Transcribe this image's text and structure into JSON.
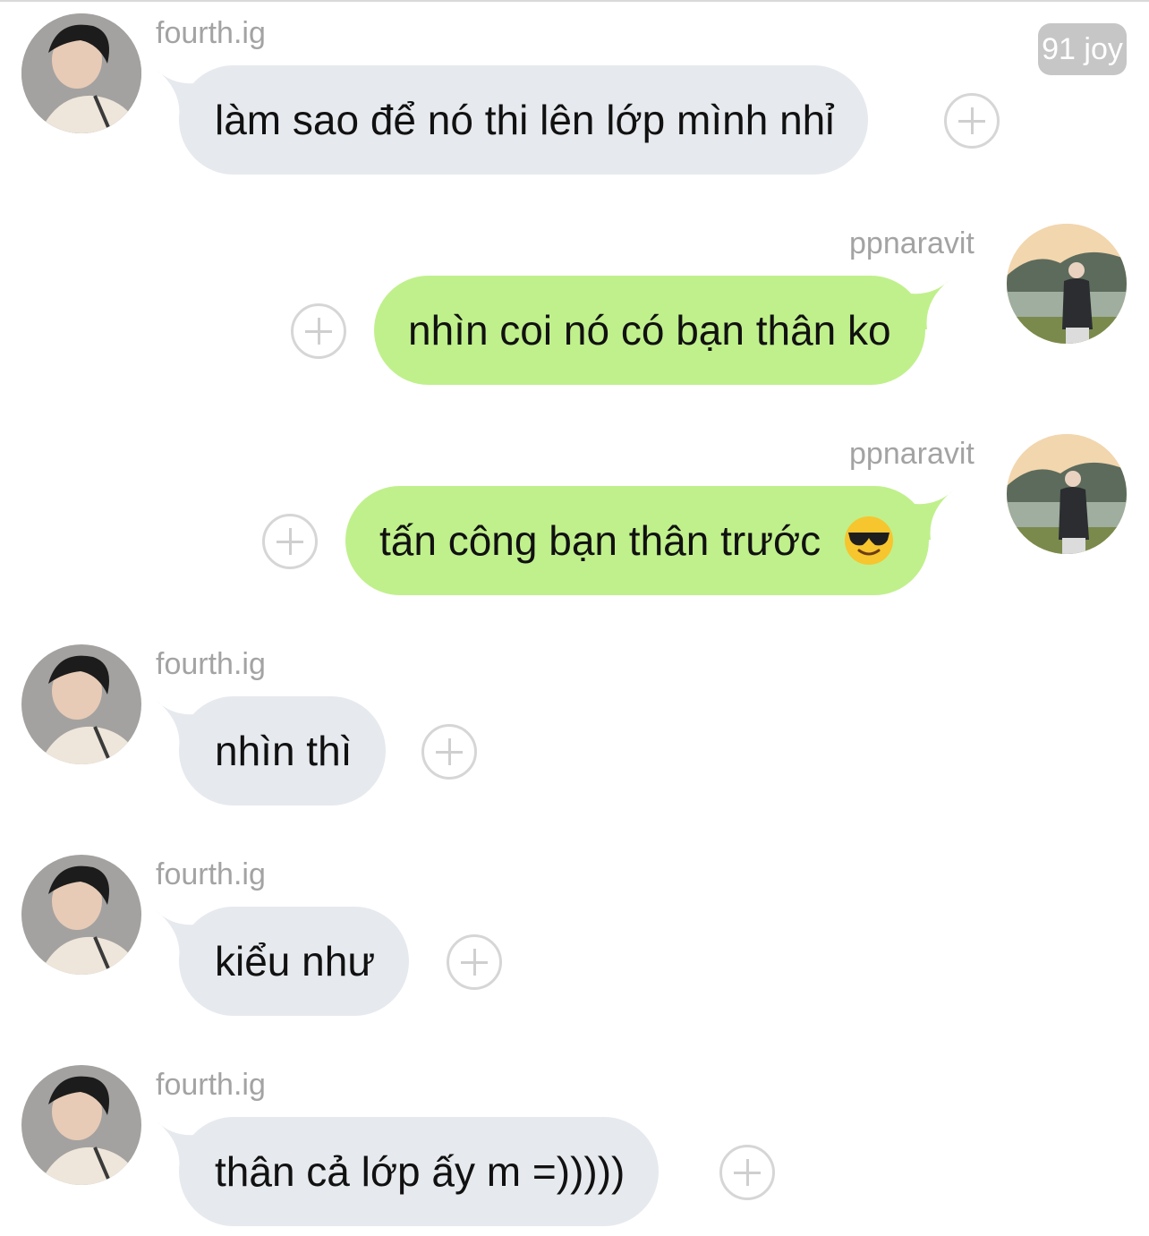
{
  "watermark": "91 joy",
  "messages": [
    {
      "sender": "fourth.ig",
      "text": "làm sao để nó thi lên lớp mình nhỉ",
      "direction": "incoming"
    },
    {
      "sender": "ppnaravit",
      "text": "nhìn coi nó có bạn thân ko",
      "direction": "outgoing"
    },
    {
      "sender": "ppnaravit",
      "text": "tấn công bạn thân trước",
      "emoji": "smiling-face-with-sunglasses",
      "direction": "outgoing"
    },
    {
      "sender": "fourth.ig",
      "text": "nhìn thì",
      "direction": "incoming"
    },
    {
      "sender": "fourth.ig",
      "text": "kiểu như",
      "direction": "incoming"
    },
    {
      "sender": "fourth.ig",
      "text": "thân cả lớp ấy m =)))))",
      "direction": "incoming"
    }
  ],
  "colors": {
    "incoming_bubble": "#e6e9ed",
    "outgoing_bubble": "#c0f08c",
    "sender_name": "#a3a3a3",
    "message_text": "#111111"
  },
  "icons": {
    "reaction": "plus-circle-icon",
    "avatar_incoming": "user-avatar",
    "avatar_outgoing": "user-avatar"
  }
}
